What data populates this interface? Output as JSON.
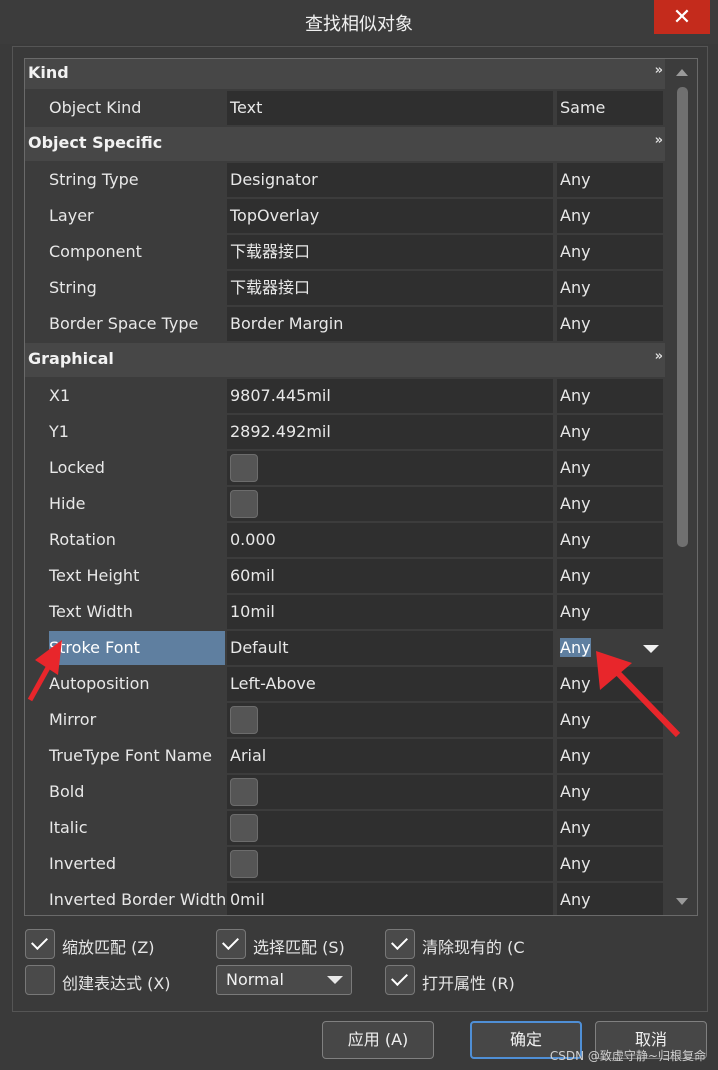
{
  "window": {
    "title": "查找相似对象",
    "close_glyph": "✕"
  },
  "grid": {
    "categories": {
      "kind": "Kind",
      "object_specific": "Object Specific",
      "graphical": "Graphical"
    },
    "chevron_glyph": "»",
    "object_kind": {
      "name": "Object Kind",
      "value": "Text",
      "mode": "Same"
    },
    "string_type": {
      "name": "String Type",
      "value": "Designator",
      "mode": "Any"
    },
    "layer": {
      "name": "Layer",
      "value": "TopOverlay",
      "mode": "Any"
    },
    "component": {
      "name": "Component",
      "value": "下载器接口",
      "mode": "Any"
    },
    "string": {
      "name": "String",
      "value": "下载器接口",
      "mode": "Any"
    },
    "border_space_type": {
      "name": "Border Space Type",
      "value": "Border Margin",
      "mode": "Any"
    },
    "x1": {
      "name": "X1",
      "value": "9807.445mil",
      "mode": "Any"
    },
    "y1": {
      "name": "Y1",
      "value": "2892.492mil",
      "mode": "Any"
    },
    "locked": {
      "name": "Locked",
      "mode": "Any"
    },
    "hide": {
      "name": "Hide",
      "mode": "Any"
    },
    "rotation": {
      "name": "Rotation",
      "value": "0.000",
      "mode": "Any"
    },
    "text_height": {
      "name": "Text Height",
      "value": "60mil",
      "mode": "Any"
    },
    "text_width": {
      "name": "Text Width",
      "value": "10mil",
      "mode": "Any"
    },
    "stroke_font": {
      "name": "Stroke Font",
      "value": "Default",
      "mode": "Any"
    },
    "autoposition": {
      "name": "Autoposition",
      "value": "Left-Above",
      "mode": "Any"
    },
    "mirror": {
      "name": "Mirror",
      "mode": "Any"
    },
    "truetype_font_name": {
      "name": "TrueType Font Name",
      "value": "Arial",
      "mode": "Any"
    },
    "bold": {
      "name": "Bold",
      "mode": "Any"
    },
    "italic": {
      "name": "Italic",
      "mode": "Any"
    },
    "inverted": {
      "name": "Inverted",
      "mode": "Any"
    },
    "inverted_border_width": {
      "name": "Inverted Border Width",
      "value": "0mil",
      "mode": "Any"
    }
  },
  "options": {
    "zoom_match": {
      "label": "缩放匹配 (Z)",
      "checked": true
    },
    "select_match": {
      "label": "选择匹配 (S)",
      "checked": true
    },
    "clear_existing": {
      "label": "清除现有的 (C",
      "checked": true
    },
    "create_expression": {
      "label": "创建表达式 (X)",
      "checked": false
    },
    "mode_select": "Normal",
    "open_properties": {
      "label": "打开属性 (R)",
      "checked": true
    }
  },
  "buttons": {
    "apply": "应用 (A)",
    "ok": "确定",
    "cancel": "取消"
  },
  "watermark": "CSDN @致虚守静~归根复命",
  "colors": {
    "selection": "#5f7fa0",
    "close": "#c42b1c",
    "annotation_arrow": "#e8262b",
    "primary_border": "#4f8fd6"
  }
}
